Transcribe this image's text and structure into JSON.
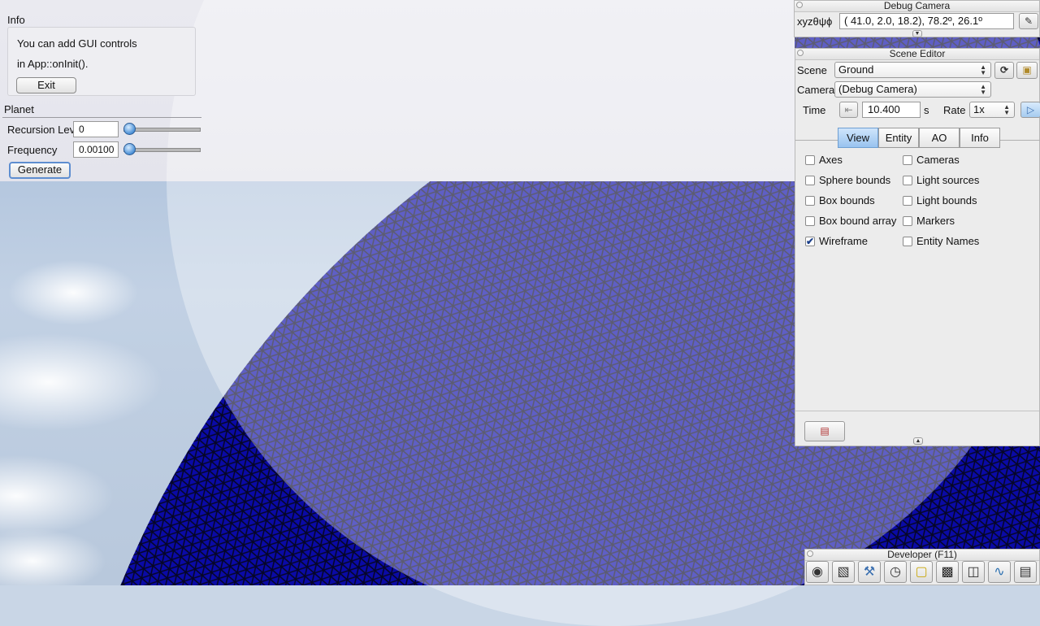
{
  "info_panel": {
    "title": "Info",
    "text_line1": "You can add GUI controls",
    "text_line2": "in App::onInit().",
    "exit_label": "Exit"
  },
  "planet_panel": {
    "title": "Planet",
    "recursion_label": "Recursion Level",
    "recursion_value": "0",
    "recursion_slider_fraction": 0.0,
    "frequency_label": "Frequency",
    "frequency_value": "0.00100",
    "frequency_slider_fraction": 0.0,
    "generate_label": "Generate"
  },
  "debug_camera": {
    "title": "Debug Camera",
    "coord_label": "xyzθψϕ",
    "coord_value": "( 41.0,   2.0,  18.2),  78.2º,  26.1º"
  },
  "scene_editor": {
    "title": "Scene Editor",
    "scene_label": "Scene",
    "scene_value": "Ground",
    "camera_label": "Camera",
    "camera_value": "(Debug Camera)",
    "time_label": "Time",
    "time_value": "10.400",
    "time_unit": "s",
    "rate_label": "Rate",
    "rate_value": "1x",
    "tabs": [
      "View",
      "Entity",
      "AO",
      "Info"
    ],
    "active_tab": "View",
    "checkboxes_left": [
      {
        "label": "Axes",
        "checked": false
      },
      {
        "label": "Sphere bounds",
        "checked": false
      },
      {
        "label": "Box bounds",
        "checked": false
      },
      {
        "label": "Box bound array",
        "checked": false
      },
      {
        "label": "Wireframe",
        "checked": true
      }
    ],
    "checkboxes_right": [
      {
        "label": "Cameras",
        "checked": false
      },
      {
        "label": "Light sources",
        "checked": false
      },
      {
        "label": "Light bounds",
        "checked": false
      },
      {
        "label": "Markers",
        "checked": false
      },
      {
        "label": "Entity Names",
        "checked": false
      }
    ]
  },
  "developer": {
    "title": "Developer (F11)",
    "icons": [
      "camera-icon",
      "film-clapper-icon",
      "tools-icon",
      "speed-dial-icon",
      "note-icon",
      "terminal-icon",
      "scene-editor-icon",
      "profiler-icon",
      "document-icon"
    ]
  },
  "colors": {
    "sphere": "#0a0a9e",
    "wire": "#0b0b33",
    "accent": "#4a90d6"
  }
}
